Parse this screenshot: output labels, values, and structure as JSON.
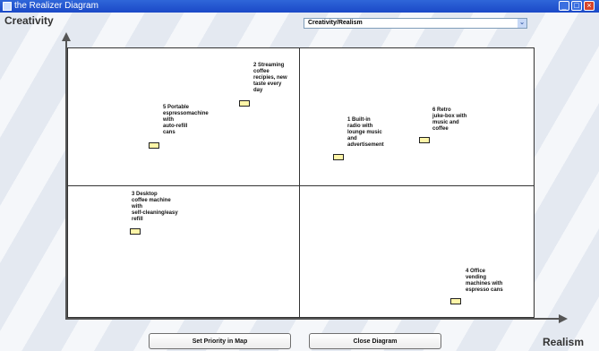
{
  "window": {
    "title": "the Realizer Diagram",
    "controls": {
      "minimize": "_",
      "maximize": "□",
      "close": "×"
    }
  },
  "axes": {
    "y_label": "Creativity",
    "x_label": "Realism"
  },
  "view_select": {
    "value": "Creativity/Realism",
    "chevron": "⌄"
  },
  "ideas": [
    {
      "label": "2 Streaming\ncoffee\nrecipies, new\ntaste every\nday",
      "level_icon": "note"
    },
    {
      "label": "5 Portable\nespressomachine\nwith\nauto-refill\ncans",
      "level_icon": "note"
    },
    {
      "label": "1 Built-in\nradio with\nlounge music\nand\nadvertisement",
      "level_icon": "note"
    },
    {
      "label": "6 Retro\njuke-box with\nmusic and\ncoffee",
      "level_icon": "note"
    },
    {
      "label": "3 Desktop\ncoffee machine\nwith\nself-cleaning/easy\nrefill",
      "level_icon": "note"
    },
    {
      "label": "4 Office\nvending\nmachines with\nespresso cans",
      "level_icon": "note"
    }
  ],
  "buttons": {
    "set_priority": "Set Priority in Map",
    "close_diagram": "Close Diagram"
  },
  "colors": {
    "titlebar": "#2f66d9",
    "note_fill": "#fff5a8"
  }
}
